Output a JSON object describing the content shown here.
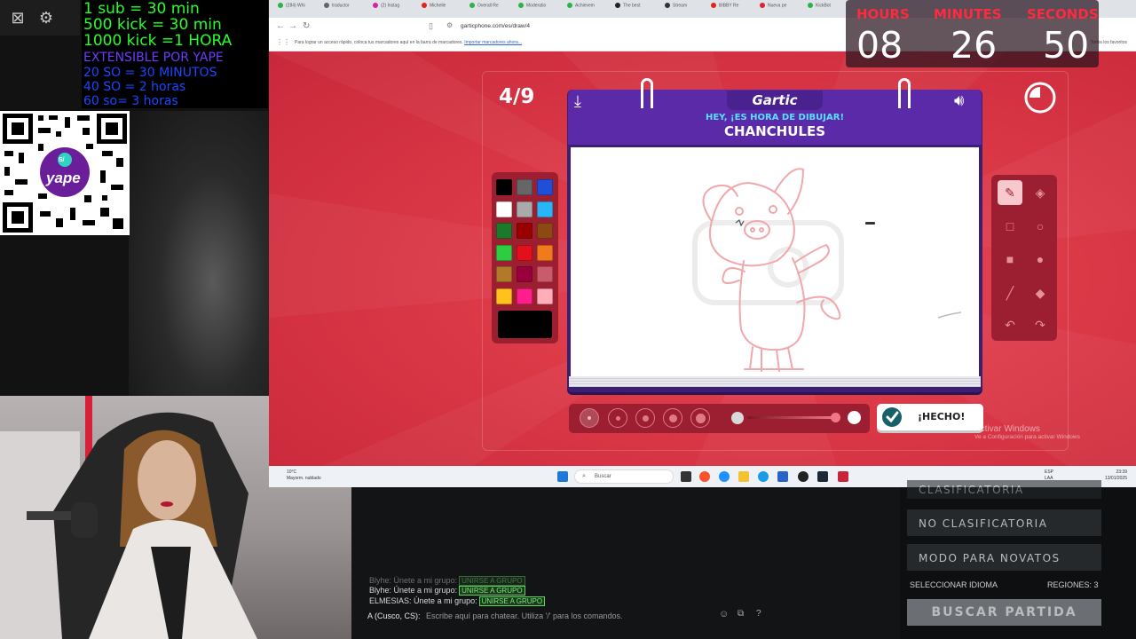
{
  "left_overlay": {
    "rules": [
      "1 sub = 30 min",
      "500 kick = 30 min",
      "1000 kick =1 HORA"
    ],
    "extensible": "EXTENSIBLE POR   YAPE",
    "so_rules": [
      "20 SO = 30 MINUTOS",
      "40 SO = 2 horas",
      "60 so= 3 horas"
    ],
    "qr_label": "yape",
    "qr_badge": "S/"
  },
  "browser": {
    "tabs": [
      "(284) Whi",
      "traductor",
      "(2) Instag",
      "Michelle",
      "Overall Re",
      "Moderatio",
      "Achievem",
      "The best",
      "Stream",
      "BIBBY Re",
      "Nueva pe",
      "KickBot"
    ],
    "url": "garticphone.com/es/draw/4",
    "bookmarks_text": "Para lograr un acceso rápido, coloca tus marcadores aquí en la barra de marcadores.",
    "bookmarks_link": "Importar marcadores ahora...",
    "other_bookmarks": "Todos los favoritos"
  },
  "game": {
    "round": "4/9",
    "logo": "Gartic",
    "prompt_label": "HEY, ¡ES HORA DE DIBUJAR!",
    "prompt_word": "CHANCHULES",
    "done_label": "¡HECHO!",
    "colors": [
      "#000000",
      "#666666",
      "#1f4fd8",
      "#ffffff",
      "#aaaaaa",
      "#29b6f6",
      "#1a7a2a",
      "#990000",
      "#8a4a12",
      "#2ecc40",
      "#e3101c",
      "#f07a1c",
      "#b07a2a",
      "#99003b",
      "#c95b6b",
      "#ffc21a",
      "#ff1e8c",
      "#ffadb8"
    ],
    "current_color": "#000000",
    "stroke_color": "#f0a8ac",
    "tools": [
      "pencil-icon",
      "eraser-icon",
      "rectangle-outline-icon",
      "circle-outline-icon",
      "rectangle-fill-icon",
      "circle-fill-icon",
      "line-icon",
      "bucket-icon",
      "undo-icon",
      "redo-icon"
    ],
    "brush_sizes": 5,
    "selected_brush": 1
  },
  "countdown": {
    "hours_label": "HOURS",
    "minutes_label": "MINUTES",
    "seconds_label": "SECONDS",
    "hours": "08",
    "minutes": "26",
    "seconds": "50"
  },
  "windows": {
    "activate_title": "Activar Windows",
    "activate_sub": "Ve a Configuración para activar Windows",
    "weather_temp": "10°C",
    "weather_desc": "Mayorm. nublado",
    "search_placeholder": "Buscar",
    "lang": "ESP",
    "lang_sub": "LAA",
    "time": "23:39",
    "date": "13/01/2025"
  },
  "game_client": {
    "chat": [
      {
        "user": "Blyhe",
        "text": "Únete a mi grupo:",
        "badge": "UNIRSE A GRUPO"
      },
      {
        "user": "Blyhe",
        "text": "Únete a mi grupo:",
        "badge": "UNIRSE A GRUPO"
      },
      {
        "user": "ELMESIAS",
        "text": "Únete a mi grupo:",
        "badge": "UNIRSE A GRUPO"
      }
    ],
    "chat_channel": "A (Cusco, CS):",
    "chat_placeholder": "Escribe aquí para chatear. Utiliza '/' para los comandos.",
    "menu": [
      "CLASIFICATORIA",
      "NO CLASIFICATORIA",
      "MODO PARA NOVATOS"
    ],
    "select_language": "SELECCIONAR IDIOMA",
    "regions": "REGIONES: 3",
    "find_match": "BUSCAR PARTIDA"
  }
}
